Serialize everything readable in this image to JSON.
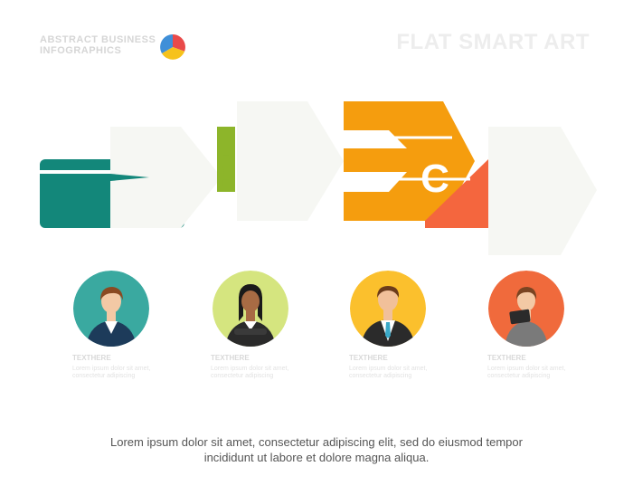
{
  "header": {
    "left_line1": "ABSTRACT BUSINESS",
    "left_line2": "INFOGRAPHICS",
    "right_title": "FLAT SMART ART"
  },
  "colors": {
    "teal": "#13877a",
    "green": "#8db52a",
    "orange": "#f59d0e",
    "coral": "#f4663e",
    "grey": "#f6f7f3"
  },
  "steps": [
    {
      "letter": "",
      "color": "#13877a",
      "icon": "person-circle-teal",
      "title": "TEXTHERE",
      "body_1": "Lorem ipsum dolor sit amet,",
      "body_2": "consectetur adipiscing"
    },
    {
      "letter": "!",
      "color": "#8db52a",
      "icon": "person-circle-green",
      "title": "TEXTHERE",
      "body_1": "Lorem ipsum dolor sit amet,",
      "body_2": "consectetur adipiscing"
    },
    {
      "letter": "C",
      "color": "#f59d0e",
      "icon": "person-circle-yellow",
      "title": "TEXTHERE",
      "body_1": "Lorem ipsum dolor sit amet,",
      "body_2": "consectetur adipiscing"
    },
    {
      "letter": "",
      "color": "#f4663e",
      "icon": "person-circle-coral",
      "title": "TEXTHERE",
      "body_1": "Lorem ipsum dolor sit amet,",
      "body_2": "consectetur adipiscing"
    }
  ],
  "footer": {
    "line1": "Lorem ipsum dolor sit amet, consectetur adipiscing elit, sed do eiusmod tempor",
    "line2": "incididunt ut labore et dolore magna aliqua."
  }
}
